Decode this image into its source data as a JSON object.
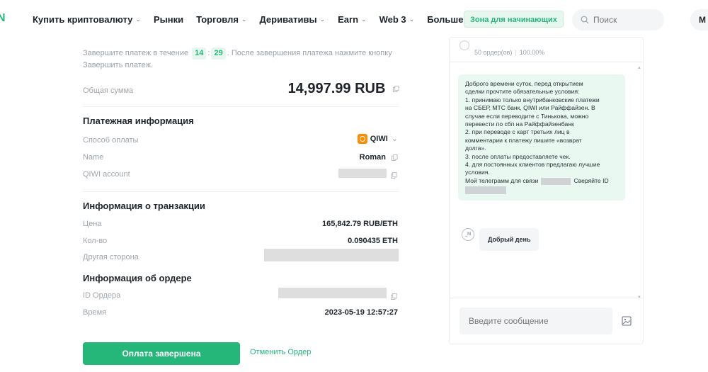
{
  "nav": {
    "logo": "N",
    "items": [
      {
        "label": "Купить криптовалюту",
        "chevron": true
      },
      {
        "label": "Рынки",
        "chevron": false
      },
      {
        "label": "Торговля",
        "chevron": true
      },
      {
        "label": "Деривативы",
        "chevron": true
      },
      {
        "label": "Earn",
        "chevron": true
      },
      {
        "label": "Web 3",
        "chevron": true
      },
      {
        "label": "Больше",
        "chevron": true
      }
    ],
    "beginner_badge": "Зона для начинающих",
    "search_placeholder": "Поиск",
    "avatar_text": "M"
  },
  "payment": {
    "timer_prefix": "Завершите платеж в течение",
    "timer_minutes": "14",
    "timer_seconds": "29",
    "timer_suffix": ". После завершения платежа нажмите кнопку Завершить платеж.",
    "total_label": "Общая сумма",
    "total_amount": "14,997.99 RUB",
    "info_title": "Платежная информация",
    "method_label": "Способ оплаты",
    "method_value": "QIWI",
    "name_label": "Name",
    "name_value": "Roman",
    "account_label": "QIWI account"
  },
  "transaction": {
    "title": "Информация о транзакции",
    "price_label": "Цена",
    "price_value": "165,842.79 RUB/ETH",
    "qty_label": "Кол-во",
    "qty_value": "0.090435 ETH",
    "counterparty_label": "Другая сторона"
  },
  "order": {
    "title": "Информация об ордере",
    "id_label": "ID Ордера",
    "time_label": "Время",
    "time_value": "2023-05-19 12:57:27"
  },
  "actions": {
    "paid_button": "Оплата завершена",
    "cancel_link": "Отменить Ордер"
  },
  "chat": {
    "orders_count": "50 ордер(ов)",
    "completion_rate": "100.00%",
    "seller_message_lines": [
      "Доброго времени суток, перед открытием",
      "сделки прочтите обязательные условия:",
      "1. принимаю только внутрибанковские платежи",
      "на СБЕР, МТС банк, QIWI или Райффайзен. В",
      "случае если переводите с Тинькова, можно",
      "перевести по сбп на Райффайзенбанк",
      "2. при переводе с карт третьих лиц в",
      "комментарии к платежу пишите «возврат",
      "долга».",
      "3. после оплаты предоставляете чек.",
      "4. для постоянных клиентов предлагаю лучшие",
      "условия."
    ],
    "telegram_prefix": "Мой телеграмм для связи",
    "telegram_suffix": "Сверяйте ID",
    "user_avatar": "_M",
    "user_message": "Добрый день",
    "input_placeholder": "Введите сообщение"
  },
  "colors": {
    "accent": "#25b67a",
    "accent_bg": "#e7f7ef",
    "qiwi": "#ff8c00",
    "redaction": "#dedede"
  },
  "icons": [
    "search-icon",
    "copy-icon",
    "qiwi-icon",
    "chevron-down-icon",
    "image-upload-icon"
  ]
}
